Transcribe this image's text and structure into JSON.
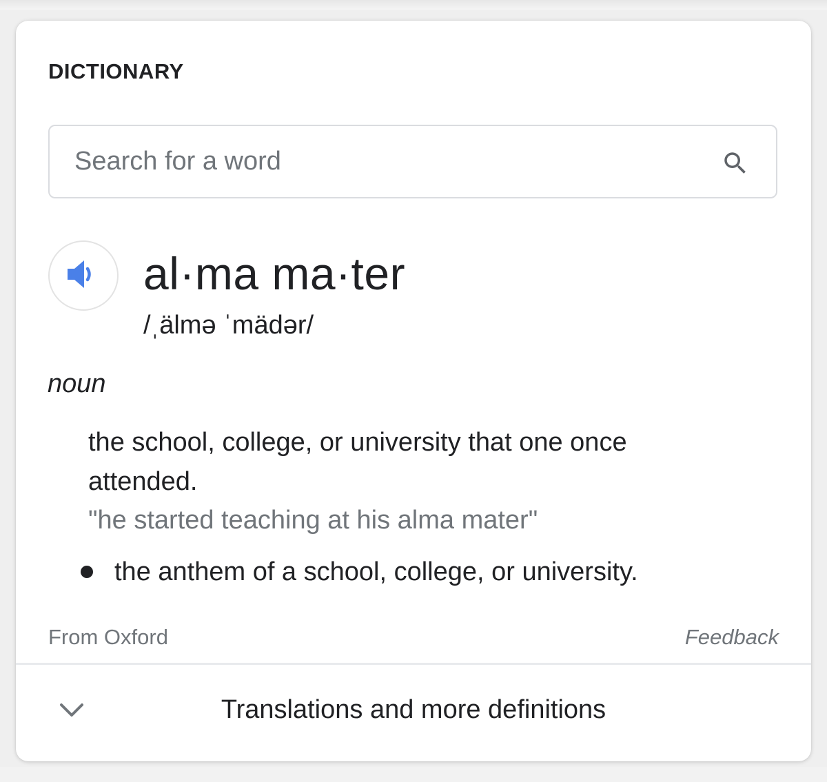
{
  "card": {
    "heading": "DICTIONARY"
  },
  "search": {
    "placeholder": "Search for a word",
    "value": "",
    "icon": "search-icon"
  },
  "entry": {
    "audio_icon": "speaker-icon",
    "word": "al·ma ma·ter",
    "pronunciation": "/ˌälmə ˈmädər/",
    "part_of_speech": "noun",
    "definition": "the school, college, or university that one once attended.",
    "example": "\"he started teaching at his alma mater\"",
    "sub_definition": "the anthem of a school, college, or university."
  },
  "footer": {
    "source": "From Oxford",
    "feedback": "Feedback"
  },
  "more": {
    "label": "Translations and more definitions",
    "icon": "chevron-down-icon"
  },
  "colors": {
    "accent": "#4a80e8",
    "text": "#202124",
    "muted": "#70757a",
    "border": "#dadce0"
  }
}
